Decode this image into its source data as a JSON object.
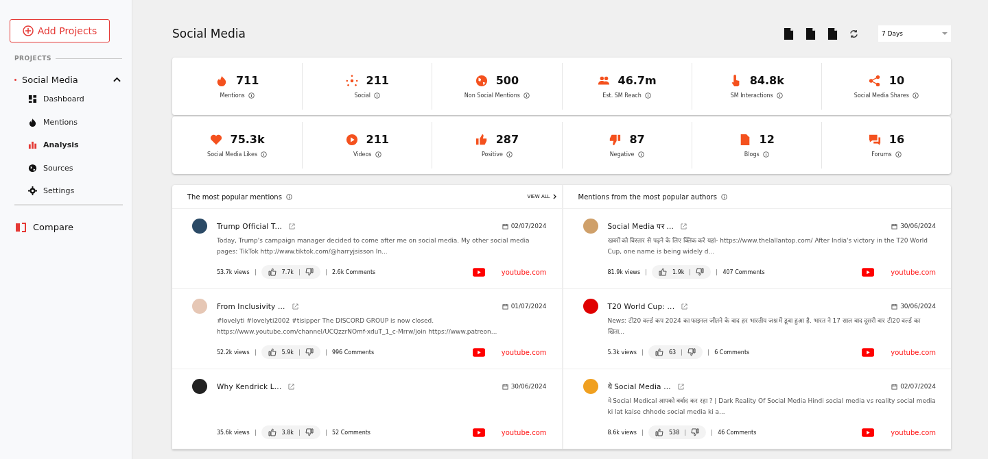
{
  "sidebar": {
    "add_button": "Add Projects",
    "section_label": "PROJECTS",
    "project": {
      "name": "Social Media",
      "expanded": true,
      "items": [
        {
          "label": "Dashboard",
          "selected": false
        },
        {
          "label": "Mentions",
          "selected": false
        },
        {
          "label": "Analysis",
          "selected": true
        },
        {
          "label": "Sources",
          "selected": false
        },
        {
          "label": "Settings",
          "selected": false
        }
      ]
    },
    "compare": "Compare"
  },
  "header": {
    "title": "Social Media",
    "period": "7 Days"
  },
  "stats": [
    {
      "value": "711",
      "label": "Mentions"
    },
    {
      "value": "211",
      "label": "Social"
    },
    {
      "value": "500",
      "label": "Non Social Mentions"
    },
    {
      "value": "46.7m",
      "label": "Est. SM Reach"
    },
    {
      "value": "84.8k",
      "label": "SM Interactions"
    },
    {
      "value": "10",
      "label": "Social Media Shares"
    },
    {
      "value": "75.3k",
      "label": "Social Media Likes"
    },
    {
      "value": "211",
      "label": "Videos"
    },
    {
      "value": "287",
      "label": "Positive"
    },
    {
      "value": "87",
      "label": "Negative"
    },
    {
      "value": "12",
      "label": "Blogs"
    },
    {
      "value": "16",
      "label": "Forums"
    }
  ],
  "panels": [
    {
      "title": "The most popular mentions",
      "view_all": "VIEW ALL",
      "items": [
        {
          "title": "Trump Official T...",
          "date": "02/07/2024",
          "text": "Today, Trump's campaign manager decided to come after me on social media. My other social media pages: TikTok http://www.tiktok.com/@harryjsisson In...",
          "views": "53.7k views",
          "likes": "7.7k",
          "comments": "2.6k Comments",
          "source": "youtube.com"
        },
        {
          "title": "From Inclusivity ...",
          "date": "01/07/2024",
          "text": "#lovelyti #lovelyti2002 #tisipper The DISCORD GROUP is now closed. https://www.youtube.com/channel/UCQzzrNOmf-xduT_1_c-Mrrw/join https://www.patreon...",
          "views": "52.2k views",
          "likes": "5.9k",
          "comments": "996 Comments",
          "source": "youtube.com"
        },
        {
          "title": "Why Kendrick L...",
          "date": "30/06/2024",
          "views": "35.6k views",
          "likes": "3.8k",
          "comments": "52 Comments",
          "source": "youtube.com"
        }
      ]
    },
    {
      "title": "Mentions from the most popular authors",
      "items": [
        {
          "title": "Social Media पर ...",
          "date": "30/06/2024",
          "text": "खबरों को विस्तार से पढ़ने के लिए क्लिक करे यहां- https://www.thelallantop.com/ After India's victory in the T20 World Cup, one name is being widely d...",
          "views": "81.9k views",
          "likes": "1.9k",
          "comments": "407 Comments",
          "source": "youtube.com"
        },
        {
          "title": "T20 World Cup: ...",
          "date": "30/06/2024",
          "text": "News: टी20 वर्ल्ड कप 2024 का फाइनल जीतने के बाद हर भारतीय जश्न में डूबा हुआ है. भारत ने 17 साल बाद दूसरी बार टी20 वर्ल्ड का खिता...",
          "views": "5.3k views",
          "likes": "63",
          "comments": "6 Comments",
          "source": "youtube.com"
        },
        {
          "title": "ये Social Media ...",
          "date": "02/07/2024",
          "text": "ये Social Medical आपको बर्बाद कर रहा ? | Dark Reality Of Social Media Hindi social media vs reality social media ki lat kaise chhode social media ki a...",
          "views": "8.6k views",
          "likes": "538",
          "comments": "46 Comments",
          "source": "youtube.com"
        }
      ]
    }
  ]
}
